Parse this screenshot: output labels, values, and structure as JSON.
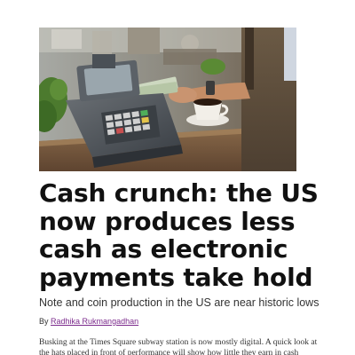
{
  "hero_image": {
    "alt": "Person paying with cash at a cash register next to a cup of coffee"
  },
  "article": {
    "headline_lines": [
      "Cash crunch: the US",
      "now produces less",
      "cash as electronic",
      "payments take hold"
    ],
    "dek": "Note and coin production in the US are near historic lows",
    "byline_prefix": "By",
    "author": "Radhika Rukmangadhan",
    "body_lines": [
      "Busking at the Times Square subway station is now mostly digital. A quick look at",
      "the hats placed in front of performance will show how little they earn in cash"
    ]
  }
}
